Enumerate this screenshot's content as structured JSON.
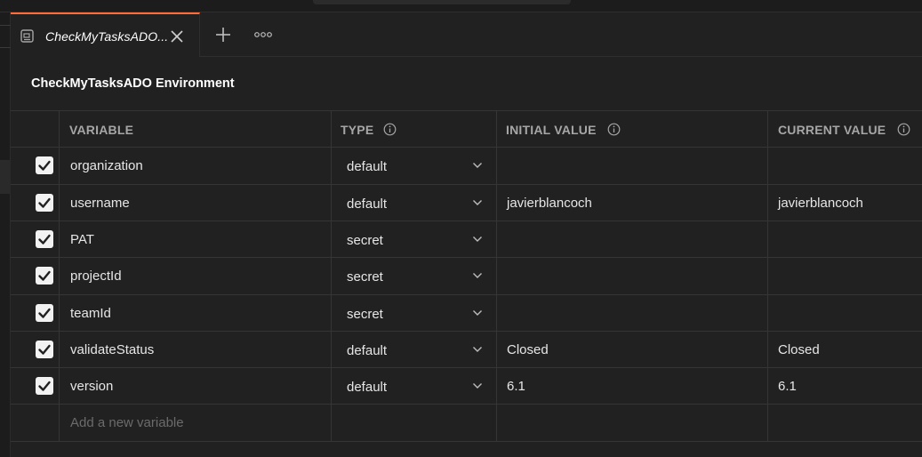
{
  "colors": {
    "background": "#212121",
    "accent": "#ff6c37",
    "checkbox": "#f2f2f2",
    "header_text": "#a6a6a6",
    "placeholder_text": "#6b6b6b"
  },
  "tab": {
    "title": "CheckMyTasksADO...",
    "icon": "environment-icon",
    "close_icon": "close-icon",
    "add_icon": "plus-icon",
    "more_icon": "more-options-icon"
  },
  "environment": {
    "title": "CheckMyTasksADO Environment"
  },
  "table": {
    "columns": {
      "variable": "VARIABLE",
      "type": "TYPE",
      "initial_value": "INITIAL VALUE",
      "current_value": "CURRENT VALUE"
    },
    "rows": [
      {
        "checked": true,
        "variable": "organization",
        "type": "default",
        "initial": "",
        "current": ""
      },
      {
        "checked": true,
        "variable": "username",
        "type": "default",
        "initial": "javierblancoch",
        "current": "javierblancoch"
      },
      {
        "checked": true,
        "variable": "PAT",
        "type": "secret",
        "initial": "",
        "current": ""
      },
      {
        "checked": true,
        "variable": "projectId",
        "type": "secret",
        "initial": "",
        "current": ""
      },
      {
        "checked": true,
        "variable": "teamId",
        "type": "secret",
        "initial": "",
        "current": ""
      },
      {
        "checked": true,
        "variable": "validateStatus",
        "type": "default",
        "initial": "Closed",
        "current": "Closed"
      },
      {
        "checked": true,
        "variable": "version",
        "type": "default",
        "initial": "6.1",
        "current": "6.1"
      }
    ],
    "new_variable_placeholder": "Add a new variable"
  }
}
